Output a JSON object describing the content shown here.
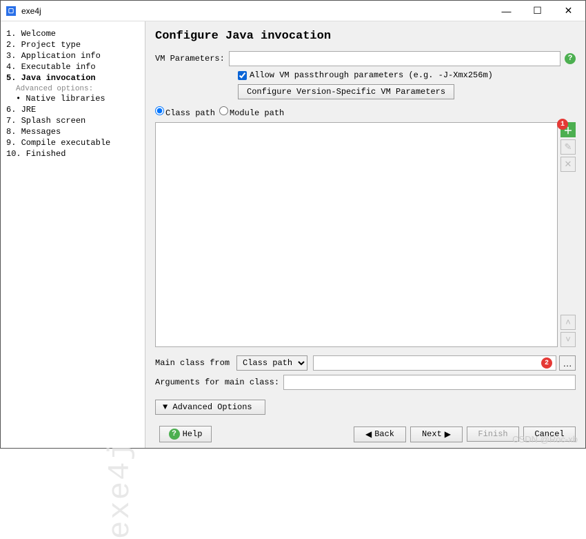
{
  "title": "exe4j",
  "sidebar": {
    "items": [
      {
        "label": "1. Welcome"
      },
      {
        "label": "2. Project type"
      },
      {
        "label": "3. Application info"
      },
      {
        "label": "4. Executable info"
      },
      {
        "label": "5. Java invocation",
        "selected": true
      },
      {
        "label": "6. JRE"
      },
      {
        "label": "7. Splash screen"
      },
      {
        "label": "8. Messages"
      },
      {
        "label": "9. Compile executable"
      },
      {
        "label": "10. Finished"
      }
    ],
    "advanced_label": "Advanced options:",
    "sub_items": [
      {
        "bullet": "•",
        "label": "Native libraries"
      }
    ],
    "watermark": "exe4j"
  },
  "main": {
    "heading": "Configure Java invocation",
    "vm_params_label": "VM Parameters:",
    "vm_params_value": "",
    "allow_passthrough_label": "Allow VM passthrough parameters (e.g. -J-Xmx256m)",
    "allow_passthrough_checked": true,
    "config_version_btn": "Configure Version-Specific VM Parameters",
    "radio_classpath": "Class path",
    "radio_modulepath": "Module path",
    "radio_selected": "classpath",
    "mainclass_from_label": "Main class from",
    "mainclass_select_options": [
      "Class path"
    ],
    "mainclass_select_value": "Class path",
    "mainclass_value": "",
    "args_label": "Arguments for main class:",
    "args_value": "",
    "advanced_options_btn": "Advanced Options",
    "badges": {
      "add": "1",
      "mainclass": "2"
    }
  },
  "footer": {
    "help": "Help",
    "back": "Back",
    "next": "Next",
    "finish": "Finish",
    "cancel": "Cancel"
  },
  "watermark_text": "CSDN @Roc-xb"
}
